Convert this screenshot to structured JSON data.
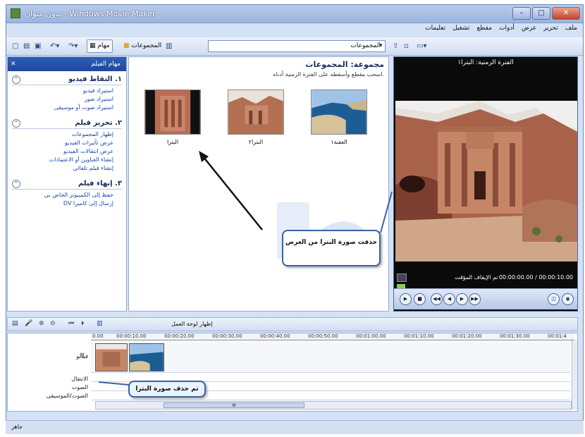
{
  "window": {
    "title": "بدون عنوان - Windows Movie Maker"
  },
  "menu": [
    "ملف",
    "تحرير",
    "عرض",
    "أدوات",
    "مقطع",
    "تشغيل",
    "تعليمات"
  ],
  "toolbar": {
    "tasks_label": "مهام",
    "collections_label": "المجموعات",
    "select_value": "المجموعات"
  },
  "tasks_pane": {
    "header": "مهام الفيلم",
    "sections": [
      {
        "title": "١. التقاط فيديو",
        "links": [
          "استيراد فيديو",
          "استيراد صور",
          "استيراد صوت أو موسيقى"
        ]
      },
      {
        "title": "٢. تحرير فيلم",
        "links": [
          "إظهار المجموعات",
          "عرض تأثيرات الفيديو",
          "عرض انتقالات الفيديو",
          "إنشاء العناوين أو الاعتمادات",
          "إنشاء فيلم تلقائي"
        ]
      },
      {
        "title": "٣. إنهاء فيلم",
        "links": [
          "حفظ إلى الكمبيوتر الخاص بي",
          "إرسال إلى كاميرا DV"
        ]
      }
    ]
  },
  "collection": {
    "title": "مجموعة: المجموعات",
    "subtitle": "اسحب مقطع وأسقطه على الفترة الزمنية أدناه.",
    "clips": [
      "البترا",
      "البترا٢",
      "العقبة١"
    ]
  },
  "preview": {
    "title": "الفترة الزمنية: البترا١",
    "status": "تم الإيقاف المؤقت",
    "time": "00:00:00.00 / 00:00:10.00"
  },
  "timeline": {
    "toolbar_label": "إظهار لوحة العمل",
    "ruler": [
      "0.00",
      "00:00:10.00",
      "00:00:20.00",
      "00:00:30.00",
      "00:00:40.00",
      "00:00:50.00",
      "00:01:00.00",
      "00:01:10.00",
      "00:01:20.00",
      "00:01:30.00",
      "00:01:4"
    ],
    "tracks": [
      "فيديو",
      "الانتقال",
      "الصوت",
      "الصوت/الموسيقى"
    ]
  },
  "callouts": {
    "preview_note": "حذفت صورة البترا من العرض",
    "timeline_note": "تم حذف صورة البترا"
  },
  "status": "جاهز",
  "colors": {
    "task_header": "#1f479a",
    "link": "#1947a8",
    "callout_border": "#3a63a8"
  }
}
